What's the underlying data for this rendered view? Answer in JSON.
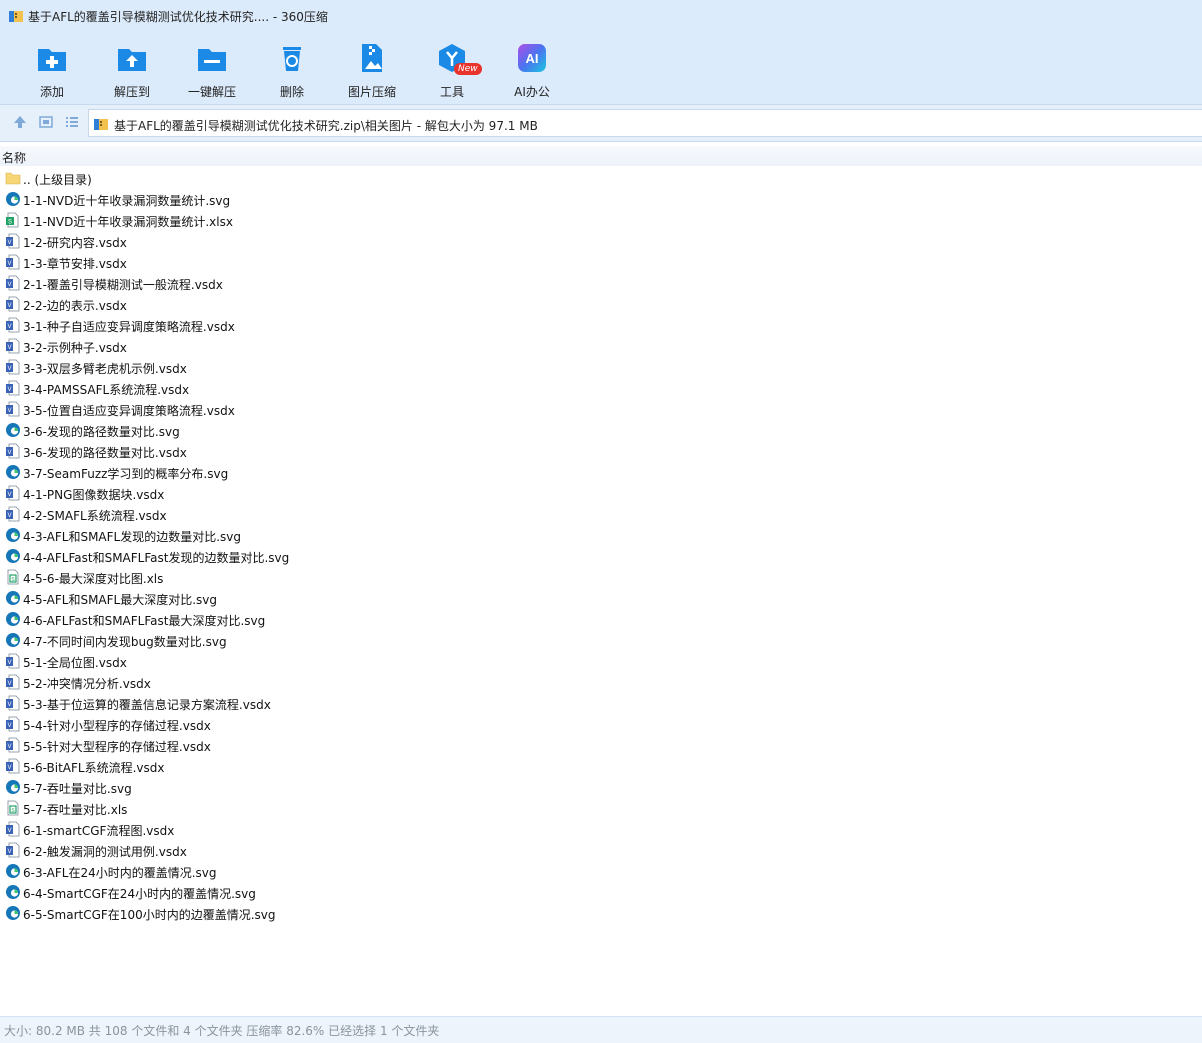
{
  "window": {
    "title": "基于AFL的覆盖引导模糊测试优化技术研究.... - 360压缩"
  },
  "toolbar": {
    "buttons": [
      {
        "label": "添加",
        "icon": "add-folder-icon"
      },
      {
        "label": "解压到",
        "icon": "extract-to-icon"
      },
      {
        "label": "一键解压",
        "icon": "one-click-extract-icon"
      },
      {
        "label": "删除",
        "icon": "delete-bin-icon"
      },
      {
        "label": "图片压缩",
        "icon": "image-compress-icon"
      },
      {
        "label": "工具",
        "icon": "tools-cube-icon"
      },
      {
        "label": "AI办公",
        "icon": "ai-office-icon"
      }
    ],
    "new_badge": "New"
  },
  "address": {
    "path": "基于AFL的覆盖引导模糊测试优化技术研究.zip\\相关图片 - 解包大小为 97.1 MB"
  },
  "list": {
    "column_name": "名称",
    "files": [
      {
        "name": ".. (上级目录)",
        "type": "folder"
      },
      {
        "name": "1-1-NVD近十年收录漏洞数量统计.svg",
        "type": "svg"
      },
      {
        "name": "1-1-NVD近十年收录漏洞数量统计.xlsx",
        "type": "xlsx"
      },
      {
        "name": "1-2-研究内容.vsdx",
        "type": "vsdx"
      },
      {
        "name": "1-3-章节安排.vsdx",
        "type": "vsdx"
      },
      {
        "name": "2-1-覆盖引导模糊测试一般流程.vsdx",
        "type": "vsdx"
      },
      {
        "name": "2-2-边的表示.vsdx",
        "type": "vsdx"
      },
      {
        "name": "3-1-种子自适应变异调度策略流程.vsdx",
        "type": "vsdx"
      },
      {
        "name": "3-2-示例种子.vsdx",
        "type": "vsdx"
      },
      {
        "name": "3-3-双层多臂老虎机示例.vsdx",
        "type": "vsdx"
      },
      {
        "name": "3-4-PAMSSAFL系统流程.vsdx",
        "type": "vsdx"
      },
      {
        "name": "3-5-位置自适应变异调度策略流程.vsdx",
        "type": "vsdx"
      },
      {
        "name": "3-6-发现的路径数量对比.svg",
        "type": "svg"
      },
      {
        "name": "3-6-发现的路径数量对比.vsdx",
        "type": "vsdx"
      },
      {
        "name": "3-7-SeamFuzz学习到的概率分布.svg",
        "type": "svg"
      },
      {
        "name": "4-1-PNG图像数据块.vsdx",
        "type": "vsdx"
      },
      {
        "name": "4-2-SMAFL系统流程.vsdx",
        "type": "vsdx"
      },
      {
        "name": "4-3-AFL和SMAFL发现的边数量对比.svg",
        "type": "svg"
      },
      {
        "name": "4-4-AFLFast和SMAFLFast发现的边数量对比.svg",
        "type": "svg"
      },
      {
        "name": "4-5-6-最大深度对比图.xls",
        "type": "xls"
      },
      {
        "name": "4-5-AFL和SMAFL最大深度对比.svg",
        "type": "svg"
      },
      {
        "name": "4-6-AFLFast和SMAFLFast最大深度对比.svg",
        "type": "svg"
      },
      {
        "name": "4-7-不同时间内发现bug数量对比.svg",
        "type": "svg"
      },
      {
        "name": "5-1-全局位图.vsdx",
        "type": "vsdx"
      },
      {
        "name": "5-2-冲突情况分析.vsdx",
        "type": "vsdx"
      },
      {
        "name": "5-3-基于位运算的覆盖信息记录方案流程.vsdx",
        "type": "vsdx"
      },
      {
        "name": "5-4-针对小型程序的存储过程.vsdx",
        "type": "vsdx"
      },
      {
        "name": "5-5-针对大型程序的存储过程.vsdx",
        "type": "vsdx"
      },
      {
        "name": "5-6-BitAFL系统流程.vsdx",
        "type": "vsdx"
      },
      {
        "name": "5-7-吞吐量对比.svg",
        "type": "svg"
      },
      {
        "name": "5-7-吞吐量对比.xls",
        "type": "xls"
      },
      {
        "name": "6-1-smartCGF流程图.vsdx",
        "type": "vsdx"
      },
      {
        "name": "6-2-触发漏洞的测试用例.vsdx",
        "type": "vsdx"
      },
      {
        "name": "6-3-AFL在24小时内的覆盖情况.svg",
        "type": "svg"
      },
      {
        "name": "6-4-SmartCGF在24小时内的覆盖情况.svg",
        "type": "svg"
      },
      {
        "name": "6-5-SmartCGF在100小时内的边覆盖情况.svg",
        "type": "svg"
      }
    ]
  },
  "status": {
    "text": "大小: 80.2 MB 共 108 个文件和 4 个文件夹 压缩率 82.6% 已经选择 1 个文件夹"
  },
  "colors": {
    "chrome_bg": "#dcebfb",
    "accent": "#1a8ae6",
    "status_text": "#8a949e"
  }
}
